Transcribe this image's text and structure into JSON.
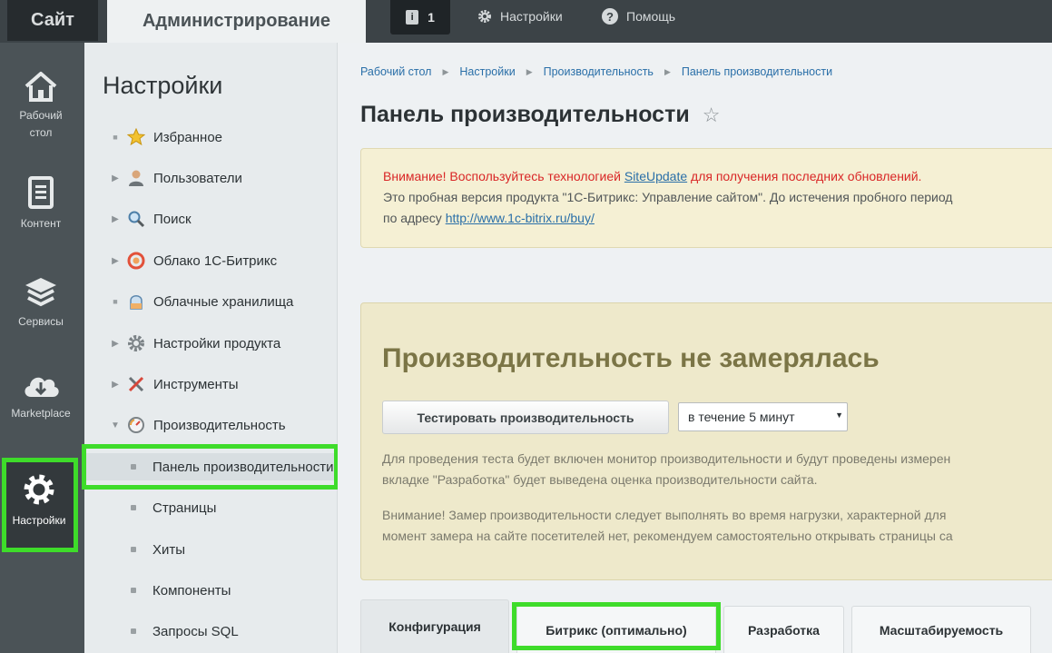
{
  "topbar": {
    "site_tab": "Сайт",
    "admin_tab": "Администрирование",
    "notifications_count": "1",
    "settings_link": "Настройки",
    "help_link": "Помощь"
  },
  "iconbar": {
    "items": [
      {
        "label_line1": "Рабочий",
        "label_line2": "стол",
        "icon": "home-icon"
      },
      {
        "label_line1": "Контент",
        "label_line2": "",
        "icon": "document-icon"
      },
      {
        "label_line1": "Сервисы",
        "label_line2": "",
        "icon": "layers-icon"
      },
      {
        "label_line1": "Marketplace",
        "label_line2": "",
        "icon": "cloud-download-icon"
      },
      {
        "label_line1": "Настройки",
        "label_line2": "",
        "icon": "gear-icon"
      }
    ]
  },
  "menu": {
    "title": "Настройки",
    "items": [
      {
        "label": "Избранное",
        "icon": "star-icon"
      },
      {
        "label": "Пользователи",
        "icon": "user-icon"
      },
      {
        "label": "Поиск",
        "icon": "magnifier-icon"
      },
      {
        "label": "Облако 1С-Битрикс",
        "icon": "cloud-icon"
      },
      {
        "label": "Облачные хранилища",
        "icon": "storage-icon"
      },
      {
        "label": "Настройки продукта",
        "icon": "cog-icon"
      },
      {
        "label": "Инструменты",
        "icon": "tools-icon"
      },
      {
        "label": "Производительность",
        "icon": "speedometer-icon"
      }
    ],
    "subitems": [
      {
        "label": "Панель производительности"
      },
      {
        "label": "Страницы"
      },
      {
        "label": "Хиты"
      },
      {
        "label": "Компоненты"
      },
      {
        "label": "Запросы SQL"
      }
    ]
  },
  "breadcrumbs": [
    "Рабочий стол",
    "Настройки",
    "Производительность",
    "Панель производительности"
  ],
  "page": {
    "title": "Панель производительности"
  },
  "alert": {
    "warning_prefix": "Внимание! Воспользуйтесь технологией ",
    "warning_link": "SiteUpdate",
    "warning_suffix": " для получения последних обновлений.",
    "trial_text": "Это пробная версия продукта \"1С-Битрикс: Управление сайтом\". До истечения пробного период",
    "address_prefix": "по адресу ",
    "address_link": "http://www.1c-bitrix.ru/buy/"
  },
  "perf": {
    "title": "Производительность не замерялась",
    "test_button": "Тестировать производительность",
    "duration_select": "в течение 5 минут",
    "info_line1": "Для проведения теста будет включен монитор производительности и будут проведены измерен",
    "info_line2": "вкладке \"Разработка\" будет выведена оценка производительности сайта.",
    "warn_line1": "Внимание! Замер производительности следует выполнять во время нагрузки, характерной для",
    "warn_line2": "момент замера на сайте посетителей нет, рекомендуем самостоятельно открывать страницы са"
  },
  "tabs": [
    {
      "label": "Конфигурация"
    },
    {
      "label": "Битрикс (оптимально)"
    },
    {
      "label": "Разработка"
    },
    {
      "label": "Масштабируемость"
    }
  ]
}
